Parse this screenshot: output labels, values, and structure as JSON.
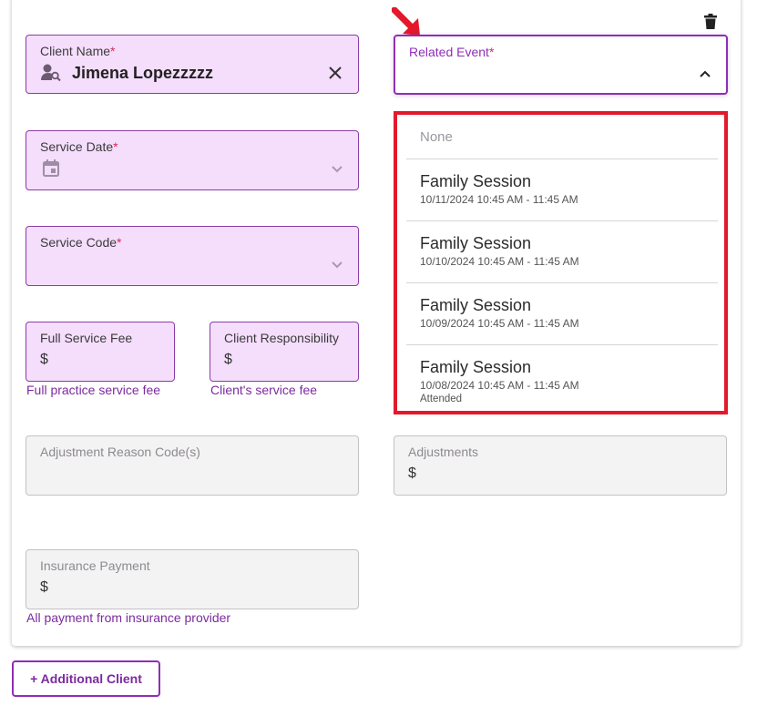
{
  "form": {
    "client_name": {
      "label": "Client Name",
      "required_mark": "*",
      "value": "Jimena Lopezzzzz"
    },
    "related_event": {
      "label": "Related Event",
      "required_mark": "*"
    },
    "service_date": {
      "label": "Service Date",
      "required_mark": "*"
    },
    "service_code": {
      "label": "Service Code",
      "required_mark": "*"
    },
    "full_service_fee": {
      "label": "Full Service Fee",
      "prefix": "$",
      "helper": "Full practice service fee"
    },
    "client_responsibility": {
      "label": "Client Responsibility",
      "prefix": "$",
      "helper": "Client's service fee"
    },
    "adjustment_reason": {
      "label": "Adjustment Reason Code(s)"
    },
    "adjustments": {
      "label": "Adjustments",
      "prefix": "$"
    },
    "insurance_payment": {
      "label": "Insurance Payment",
      "prefix": "$",
      "helper": "All payment from insurance provider"
    }
  },
  "dropdown": {
    "none_label": "None",
    "options": [
      {
        "title": "Family Session",
        "datetime": "10/11/2024 10:45 AM - 11:45 AM",
        "status": ""
      },
      {
        "title": "Family Session",
        "datetime": "10/10/2024 10:45 AM - 11:45 AM",
        "status": ""
      },
      {
        "title": "Family Session",
        "datetime": "10/09/2024 10:45 AM - 11:45 AM",
        "status": ""
      },
      {
        "title": "Family Session",
        "datetime": "10/08/2024 10:45 AM - 11:45 AM",
        "status": "Attended"
      }
    ]
  },
  "actions": {
    "add_client_label": "+ Additional Client"
  },
  "icons": {
    "delete": "trash-icon",
    "client": "person-search-icon",
    "clear": "close-icon",
    "calendar": "calendar-icon",
    "annotation": "red-arrow-icon"
  },
  "colors": {
    "accent": "#8e2fb4",
    "highlight": "#e3192b",
    "field_bg": "#f5ddfc"
  }
}
